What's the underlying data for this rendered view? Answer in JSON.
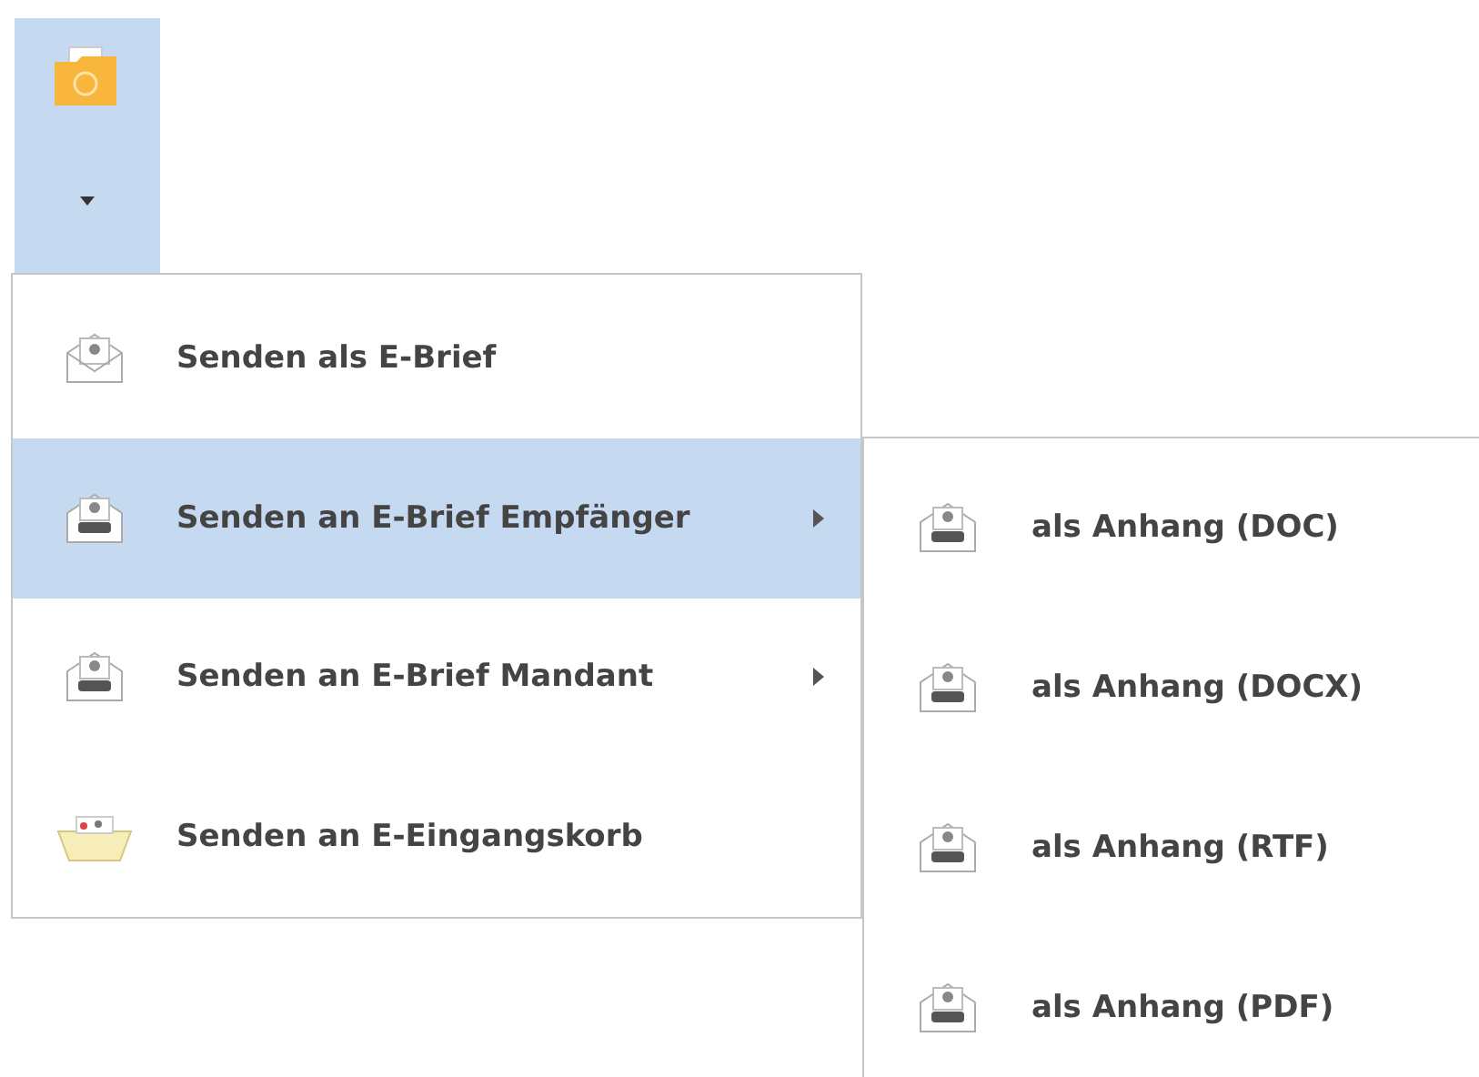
{
  "ribbon_button": {
    "selected": true
  },
  "menu": {
    "items": [
      {
        "label": "Senden als E-Brief",
        "kind": "letter",
        "selected": false,
        "has_submenu": false
      },
      {
        "label": "Senden an E-Brief Empfänger",
        "kind": "tray",
        "selected": true,
        "has_submenu": true
      },
      {
        "label": "Senden an E-Brief Mandant",
        "kind": "tray",
        "selected": false,
        "has_submenu": true
      },
      {
        "label": "Senden an E-Eingangskorb",
        "kind": "basket",
        "selected": false,
        "has_submenu": false
      }
    ]
  },
  "submenu": {
    "items": [
      {
        "label": "als Anhang (DOC)",
        "kind": "tray",
        "selected": false
      },
      {
        "label": "als Anhang (DOCX)",
        "kind": "tray",
        "selected": false
      },
      {
        "label": "als Anhang (RTF)",
        "kind": "tray",
        "selected": false
      },
      {
        "label": "als Anhang (PDF)",
        "kind": "tray",
        "selected": false
      }
    ]
  }
}
